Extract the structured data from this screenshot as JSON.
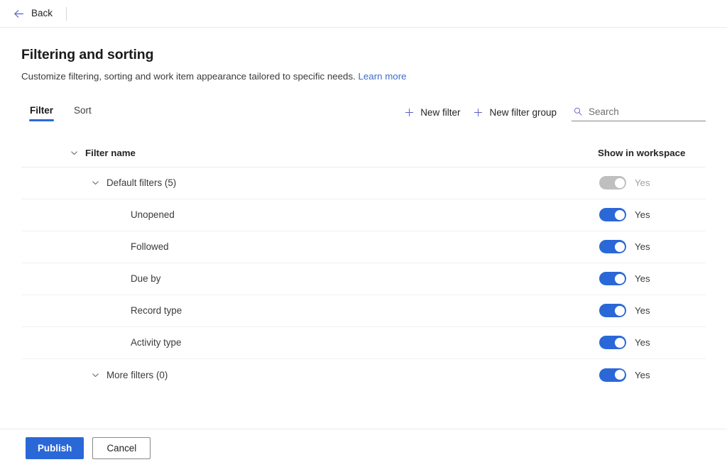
{
  "topbar": {
    "back_label": "Back",
    "back_icon": "arrow-left-icon"
  },
  "header": {
    "title": "Filtering and sorting",
    "description": "Customize filtering, sorting and work item appearance tailored to specific needs.",
    "learn_more_label": "Learn more"
  },
  "tabs": [
    {
      "label": "Filter",
      "active": true
    },
    {
      "label": "Sort",
      "active": false
    }
  ],
  "toolbar": {
    "new_filter_label": "New filter",
    "new_filter_group_label": "New filter group",
    "search_placeholder": "Search",
    "search_value": "",
    "plus_icon": "plus-icon",
    "search_icon": "search-icon"
  },
  "table": {
    "columns": {
      "name": "Filter name",
      "show_in_workspace": "Show in workspace"
    },
    "rows": [
      {
        "label": "Default filters (5)",
        "indent": 1,
        "has_chevron": true,
        "toggle_on": true,
        "toggle_disabled": true,
        "toggle_label": "Yes",
        "divider": true
      },
      {
        "label": "Unopened",
        "indent": 2,
        "has_chevron": false,
        "toggle_on": true,
        "toggle_disabled": false,
        "toggle_label": "Yes",
        "divider": true
      },
      {
        "label": "Followed",
        "indent": 2,
        "has_chevron": false,
        "toggle_on": true,
        "toggle_disabled": false,
        "toggle_label": "Yes",
        "divider": true
      },
      {
        "label": "Due by",
        "indent": 2,
        "has_chevron": false,
        "toggle_on": true,
        "toggle_disabled": false,
        "toggle_label": "Yes",
        "divider": true
      },
      {
        "label": "Record type",
        "indent": 2,
        "has_chevron": false,
        "toggle_on": true,
        "toggle_disabled": false,
        "toggle_label": "Yes",
        "divider": true
      },
      {
        "label": "Activity type",
        "indent": 2,
        "has_chevron": false,
        "toggle_on": true,
        "toggle_disabled": false,
        "toggle_label": "Yes",
        "divider": true
      },
      {
        "label": "More filters (0)",
        "indent": 1,
        "has_chevron": true,
        "toggle_on": true,
        "toggle_disabled": false,
        "toggle_label": "Yes",
        "divider": false
      }
    ]
  },
  "footer": {
    "publish_label": "Publish",
    "cancel_label": "Cancel"
  },
  "colors": {
    "accent": "#2a68d8",
    "icon_accent": "#5b5fc7",
    "link": "#3b6ccc",
    "toggle_on": "#2a68d8",
    "toggle_disabled": "#bfbfbf"
  }
}
